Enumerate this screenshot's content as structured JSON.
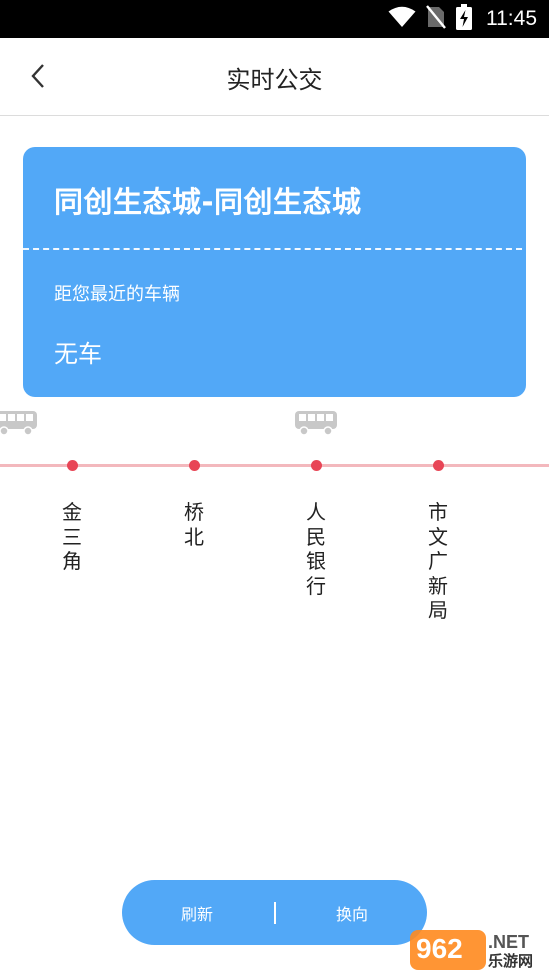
{
  "status_bar": {
    "time": "11:45",
    "icons": [
      "wifi-icon",
      "no-sim-icon",
      "battery-charging-icon"
    ]
  },
  "nav": {
    "title": "实时公交",
    "back_icon": "chevron-left-icon"
  },
  "route_card": {
    "route_name": "同创生态城-同创生态城",
    "nearest_label": "距您最近的车辆",
    "nearest_value": "无车"
  },
  "stops": [
    {
      "name": "金三角"
    },
    {
      "name": "桥北"
    },
    {
      "name": "人民银行"
    },
    {
      "name": "市文广新局"
    }
  ],
  "buses": [
    "bus-icon",
    "bus-icon"
  ],
  "actions": {
    "refresh_label": "刷新",
    "switch_direction_label": "换向"
  },
  "watermark": {
    "logo_text": "962.NET",
    "site_text": "乐游网"
  },
  "colors": {
    "accent": "#52a8f7",
    "stop_dot": "#e84556",
    "route_line": "#f3b8bd"
  }
}
